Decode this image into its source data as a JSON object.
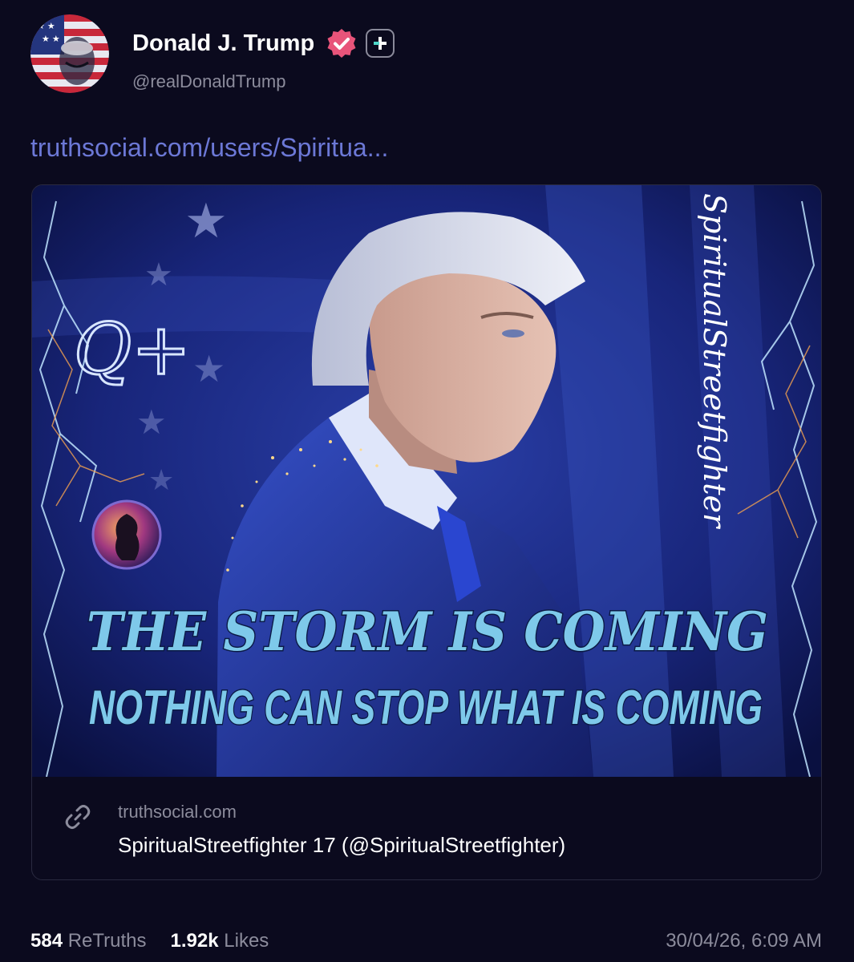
{
  "post": {
    "author_name": "Donald J. Trump",
    "author_handle": "@realDonaldTrump",
    "link_text": "truthsocial.com/users/Spiritua...",
    "icons": {
      "avatar": "avatar",
      "verified": "verified-badge-icon",
      "plus": "plus-badge-icon",
      "link": "link-chain-icon"
    }
  },
  "card": {
    "image": {
      "headline": "THE STORM IS COMING",
      "subheadline": "NOTHING CAN STOP WHAT IS COMING",
      "watermark": "SpiritualStreetfighter",
      "q_symbol": "Q+"
    },
    "domain": "truthsocial.com",
    "title": "SpiritualStreetfighter 17 (@SpiritualStreetfighter)"
  },
  "stats": {
    "retruths_count": "584",
    "retruths_label": "ReTruths",
    "likes_count": "1.92k",
    "likes_label": "Likes"
  },
  "timestamp": "30/04/26, 6:09 AM",
  "colors": {
    "background": "#0b0a1e",
    "link": "#6c78d6",
    "verified_badge": "#e8547a",
    "muted_text": "#8c8c9c",
    "headline_text": "#7ec9ea"
  }
}
